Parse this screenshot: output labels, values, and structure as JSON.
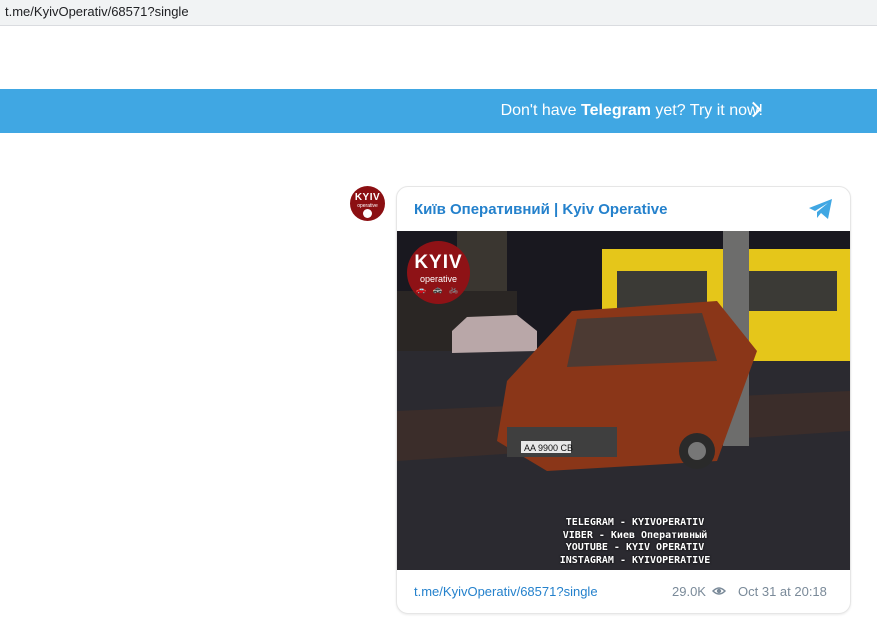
{
  "browser": {
    "url": "t.me/KyivOperativ/68571?single"
  },
  "banner": {
    "prefix": "Don't have ",
    "brand": "Telegram",
    "suffix": " yet? Try it now!"
  },
  "avatar": {
    "title": "KYIV",
    "subtitle": "operative"
  },
  "post": {
    "channel_name": "Київ Оперативний | Kyiv Operative",
    "photo": {
      "watermark_title": "KYIV",
      "watermark_sub": "operative",
      "watermark_icons": "🚗 🚓 🚲",
      "credit_lines": [
        "TELEGRAM - KYIVOPERATIV",
        "VIBER - Киев Оперативный",
        "YOUTUBE - KYIV OPERATIV",
        "INSTAGRAM - KYIVOPERATIVE"
      ],
      "plate": "AA 9900 CB"
    },
    "link": "t.me/KyivOperativ/68571?single",
    "views": "29.0K",
    "date": "Oct 31 at 20:18"
  },
  "colors": {
    "banner": "#40a7e3",
    "link": "#2481cc",
    "meta": "#7a8a99"
  },
  "icons": [
    "telegram-plane-icon",
    "eye-icon",
    "chevron-right-icon"
  ]
}
